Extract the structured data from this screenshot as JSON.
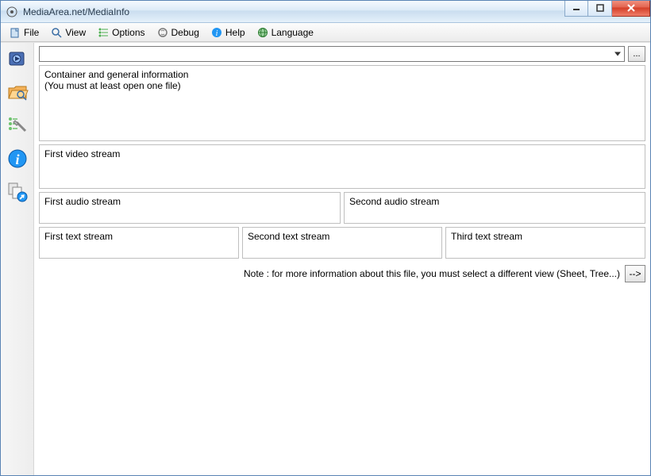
{
  "titlebar": {
    "title": "MediaArea.net/MediaInfo"
  },
  "menubar": {
    "file": "File",
    "view": "View",
    "options": "Options",
    "debug": "Debug",
    "help": "Help",
    "language": "Language"
  },
  "combo": {
    "value": "",
    "browse_label": "..."
  },
  "panels": {
    "container_label": "Container and general information",
    "container_hint": "(You must at least open one file)",
    "video1": "First video stream",
    "audio1": "First audio stream",
    "audio2": "Second audio stream",
    "text1": "First text stream",
    "text2": "Second text stream",
    "text3": "Third text stream"
  },
  "note": "Note : for more information about this file, you must select a different view (Sheet, Tree...)",
  "go_arrow": "-->"
}
